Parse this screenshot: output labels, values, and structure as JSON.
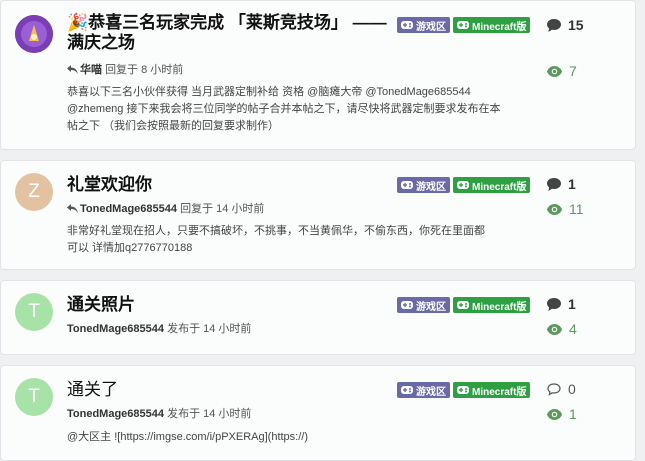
{
  "topics": [
    {
      "title": "🎉恭喜三名玩家完成 「莱斯竞技场」 —— 满庆之场",
      "avatar_letter": "",
      "avatar_color": "#7b3fb5",
      "meta_prefix_icon": "reply-icon",
      "meta_user": "华喵",
      "meta_action": "回复于 8 小时前",
      "excerpt": "恭喜以下三名小伙伴获得 当月武器定制补给 资格 @脑瘫大帝 @TonedMage685544 @zhemeng 接下来我会将三位同学的帖子合并本帖之下，请尽快将武器定制要求发布在本帖之下 （我们会按照最新的回复要求制作）",
      "tag_category": "游戏区",
      "tag_sub": "Minecraft版",
      "replies": "15",
      "views": "7"
    },
    {
      "title": "礼堂欢迎你",
      "avatar_letter": "Z",
      "avatar_color": "#e3c2a1",
      "meta_prefix_icon": "reply-icon",
      "meta_user": "TonedMage685544",
      "meta_action": "回复于 14 小时前",
      "excerpt": "非常好礼堂现在招人，只要不搞破坏，不挑事，不当黄佩华，不偷东西，你死在里面都可以 详情加q2776770188",
      "tag_category": "游戏区",
      "tag_sub": "Minecraft版",
      "replies": "1",
      "views": "11"
    },
    {
      "title": "通关照片",
      "avatar_letter": "T",
      "avatar_color": "#a7e3a6",
      "meta_user": "TonedMage685544",
      "meta_action": "发布于 14 小时前",
      "excerpt": "",
      "tag_category": "游戏区",
      "tag_sub": "Minecraft版",
      "replies": "1",
      "views": "4"
    },
    {
      "title": "通关了",
      "avatar_letter": "T",
      "avatar_color": "#a7e3a6",
      "meta_user": "TonedMage685544",
      "meta_action": "发布于 14 小时前",
      "excerpt": "@大区主 ![https://imgse.com/i/pPXERAg](https://)",
      "tag_category": "游戏区",
      "tag_sub": "Minecraft版",
      "replies": "0",
      "views": "1"
    }
  ]
}
